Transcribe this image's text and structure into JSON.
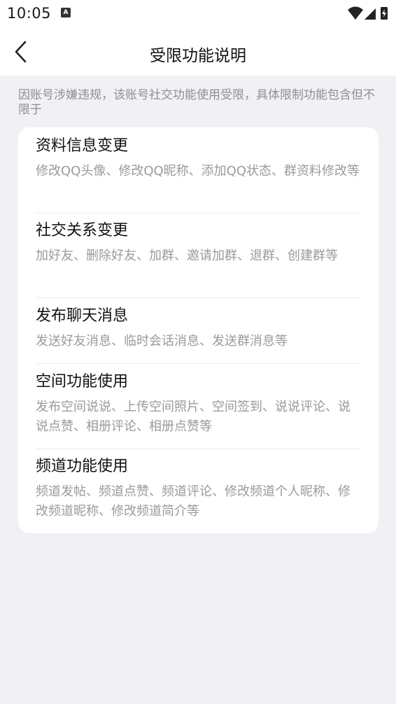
{
  "status_bar": {
    "time": "10:05",
    "notification_icon_letter": "A"
  },
  "nav": {
    "title": "受限功能说明"
  },
  "intro": "因账号涉嫌违规，该账号社交功能使用受限，具体限制功能包含但不限于",
  "items": [
    {
      "title": "资料信息变更",
      "desc": "修改QQ头像、修改QQ昵称、添加QQ状态、群资料修改等"
    },
    {
      "title": "社交关系变更",
      "desc": "加好友、删除好友、加群、邀请加群、退群、创建群等"
    },
    {
      "title": "发布聊天消息",
      "desc": "发送好友消息、临时会话消息、发送群消息等"
    },
    {
      "title": "空间功能使用",
      "desc": "发布空间说说、上传空间照片、空间签到、说说评论、说说点赞、相册评论、相册点赞等"
    },
    {
      "title": "频道功能使用",
      "desc": "频道发帖、频道点赞、频道评论、修改频道个人昵称、修改频道昵称、修改频道简介等"
    }
  ]
}
